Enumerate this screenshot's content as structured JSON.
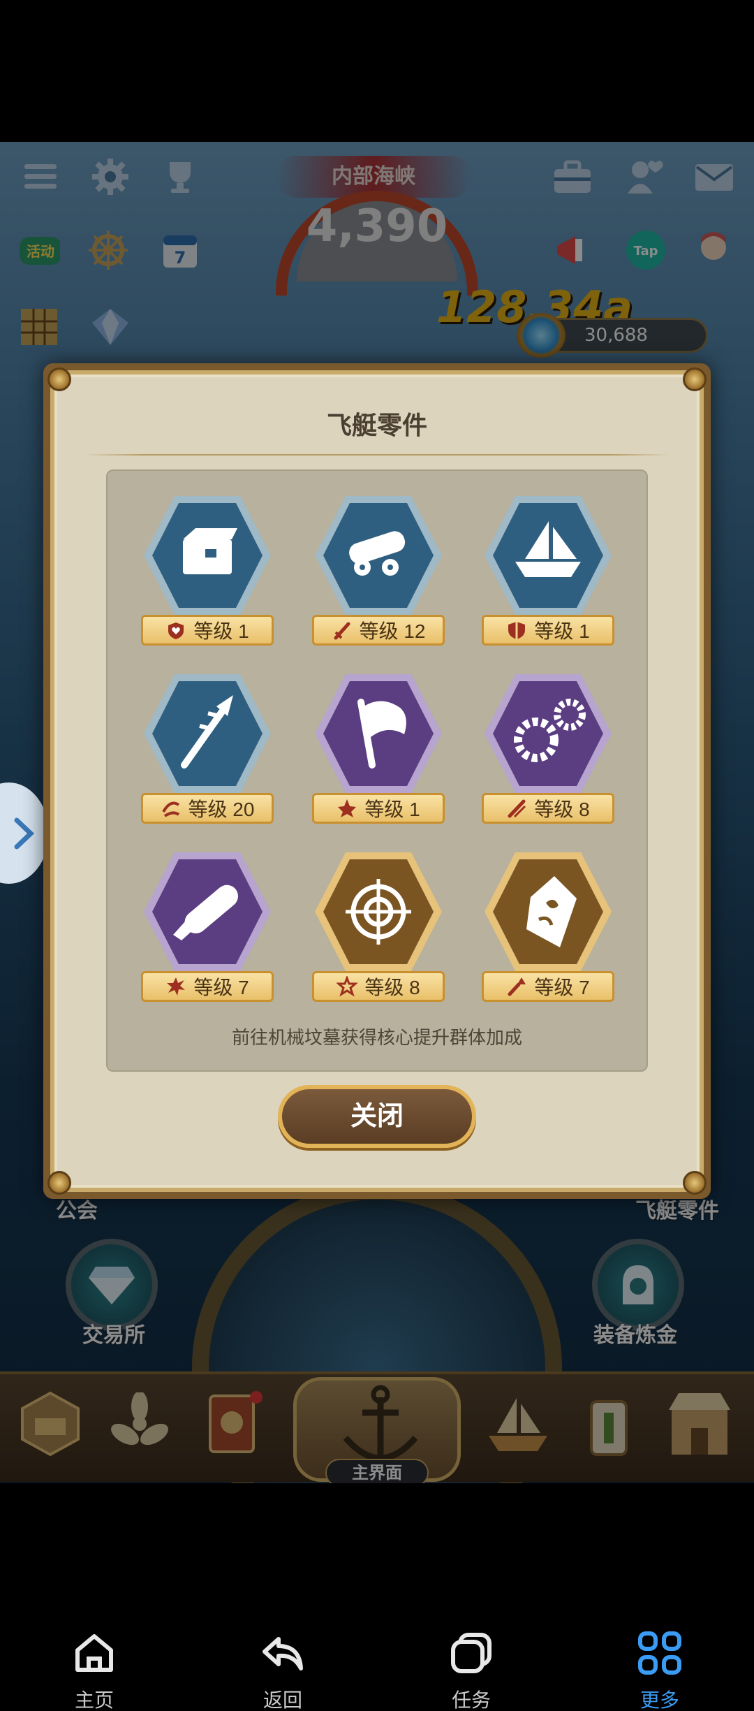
{
  "hud": {
    "sea_area_title": "内部海峡",
    "gauge_value": "4,390",
    "power_number": "128,34a",
    "coins": "30,688"
  },
  "side": {
    "guild_label": "公会",
    "airship_parts_label": "飞艇零件",
    "exchange_label": "交易所",
    "forge_label": "装备炼金"
  },
  "dialog": {
    "title": "飞艇零件",
    "parts": [
      {
        "id": "part-cargo",
        "icon": "crate-icon",
        "hex": "blue",
        "stat_icon": "heart-shield-icon",
        "level": "等级 1"
      },
      {
        "id": "part-cannon",
        "icon": "cannon-icon",
        "hex": "blue",
        "stat_icon": "sword-icon",
        "level": "等级 12"
      },
      {
        "id": "part-ship",
        "icon": "ship-icon",
        "hex": "blue",
        "stat_icon": "shield-icon",
        "level": "等级 1"
      },
      {
        "id": "part-harpoon",
        "icon": "harpoon-icon",
        "hex": "blue",
        "stat_icon": "dodge-icon",
        "level": "等级 20"
      },
      {
        "id": "part-flag",
        "icon": "flag-icon",
        "hex": "purple",
        "stat_icon": "crit-icon",
        "level": "等级 1"
      },
      {
        "id": "part-gears",
        "icon": "gears-icon",
        "hex": "purple",
        "stat_icon": "double-sword-icon",
        "level": "等级 8"
      },
      {
        "id": "part-torpedo",
        "icon": "torpedo-icon",
        "hex": "purple",
        "stat_icon": "burst-icon",
        "level": "等级 7"
      },
      {
        "id": "part-target",
        "icon": "target-icon",
        "hex": "gold",
        "stat_icon": "star-burst-icon",
        "level": "等级 8"
      },
      {
        "id": "part-core",
        "icon": "core-crystal-icon",
        "hex": "gold",
        "stat_icon": "attack-up-icon",
        "level": "等级 7"
      }
    ],
    "hint": "前往机械坟墓获得核心提升群体加成",
    "close_label": "关闭"
  },
  "bottom_bar": {
    "main_label": "主界面"
  },
  "navbar": {
    "items": [
      {
        "label": "主页",
        "icon": "home-icon"
      },
      {
        "label": "返回",
        "icon": "back-icon"
      },
      {
        "label": "任务",
        "icon": "tasks-icon"
      },
      {
        "label": "更多",
        "icon": "more-grid-icon"
      }
    ],
    "active_color": "#3a9cf5"
  },
  "colors": {
    "hex_blue": "#2f5f80",
    "hex_purple": "#5b3d82",
    "hex_gold": "#7a5522",
    "panel_bg": "#b7b19e",
    "dialog_bg": "#dcd4bd"
  }
}
